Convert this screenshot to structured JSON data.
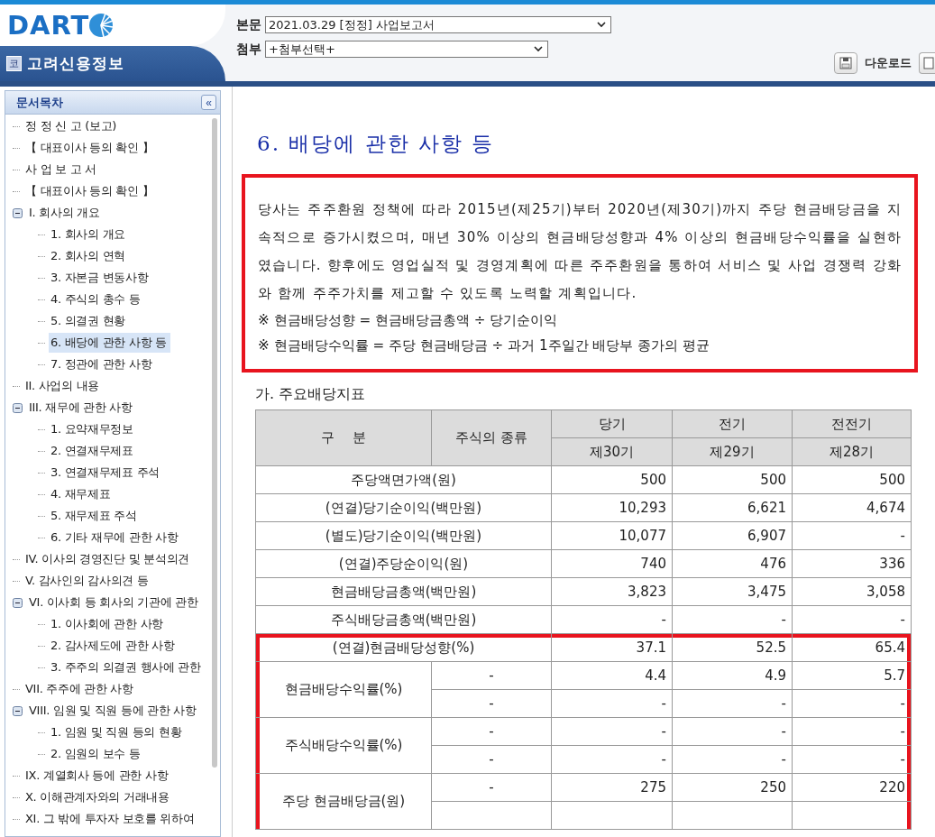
{
  "header": {
    "logo": "DART",
    "company_badge": "코",
    "company": "고려신용정보",
    "fields": [
      {
        "label": "본문",
        "value": "2021.03.29  [정정] 사업보고서"
      },
      {
        "label": "첨부",
        "value": "+첨부선택+"
      }
    ],
    "download_button": "다운로드"
  },
  "sidebar": {
    "title": "문서목차",
    "collapse": "«",
    "items": [
      {
        "label": "정 정 신 고 (보고)",
        "selected": false
      },
      {
        "label": "【 대표이사 등의 확인 】",
        "selected": false
      },
      {
        "label": "사 업 보 고 서",
        "selected": false
      },
      {
        "label": "【 대표이사 등의 확인 】",
        "selected": false
      },
      {
        "label": "I. 회사의 개요",
        "selected": false,
        "expanded": true,
        "children": [
          {
            "label": "1. 회사의 개요",
            "selected": false
          },
          {
            "label": "2. 회사의 연혁",
            "selected": false
          },
          {
            "label": "3. 자본금 변동사항",
            "selected": false
          },
          {
            "label": "4. 주식의 총수 등",
            "selected": false
          },
          {
            "label": "5. 의결권 현황",
            "selected": false
          },
          {
            "label": "6. 배당에 관한 사항 등",
            "selected": true
          },
          {
            "label": "7. 정관에 관한 사항",
            "selected": false
          }
        ]
      },
      {
        "label": "II. 사업의 내용",
        "selected": false
      },
      {
        "label": "III. 재무에 관한 사항",
        "selected": false,
        "expanded": true,
        "children": [
          {
            "label": "1. 요약재무정보",
            "selected": false
          },
          {
            "label": "2. 연결재무제표",
            "selected": false
          },
          {
            "label": "3. 연결재무제표 주석",
            "selected": false
          },
          {
            "label": "4. 재무제표",
            "selected": false
          },
          {
            "label": "5. 재무제표 주석",
            "selected": false
          },
          {
            "label": "6. 기타 재무에 관한 사항",
            "selected": false
          }
        ]
      },
      {
        "label": "IV. 이사의 경영진단 및 분석의견",
        "selected": false
      },
      {
        "label": "V. 감사인의 감사의견 등",
        "selected": false
      },
      {
        "label": "VI. 이사회 등 회사의 기관에 관한",
        "selected": false,
        "expanded": true,
        "children": [
          {
            "label": "1. 이사회에 관한 사항",
            "selected": false
          },
          {
            "label": "2. 감사제도에 관한 사항",
            "selected": false
          },
          {
            "label": "3. 주주의 의결권 행사에 관한",
            "selected": false
          }
        ]
      },
      {
        "label": "VII. 주주에 관한 사항",
        "selected": false
      },
      {
        "label": "VIII. 임원 및 직원 등에 관한 사항",
        "selected": false,
        "expanded": true,
        "children": [
          {
            "label": "1. 임원 및 직원 등의 현황",
            "selected": false
          },
          {
            "label": "2. 임원의 보수 등",
            "selected": false
          }
        ]
      },
      {
        "label": "IX. 계열회사 등에 관한 사항",
        "selected": false
      },
      {
        "label": "X. 이해관계자와의 거래내용",
        "selected": false
      },
      {
        "label": "XI. 그 밖에 투자자 보호를 위하여",
        "selected": false
      }
    ]
  },
  "document": {
    "title": "6. 배당에 관한 사항 등",
    "intro": {
      "highlighted": true,
      "paragraph": "당사는 주주환원 정책에 따라 2015년(제25기)부터 2020년(제30기)까지 주당 현금배당금을 지속적으로 증가시켰으며, 매년 30% 이상의 현금배당성향과 4% 이상의 현금배당수익률을 실현하였습니다. 향후에도 영업실적 및 경영계획에 따른 주주환원을 통하여 서비스 및 사업 경쟁력 강화와 함께 주주가치를 제고할 수 있도록 노력할 계획입니다.",
      "notes": [
        "※ 현금배당성향 = 현금배당금총액 ÷ 당기순이익",
        "※ 현금배당수익률 = 주당 현금배당금 ÷ 과거 1주일간 배당부 종가의 평균"
      ]
    },
    "section": "가. 주요배당지표",
    "table": {
      "columns": [
        {
          "label": "구    분"
        },
        {
          "label": "주식의 종류"
        },
        {
          "label": "당기",
          "sub": "제30기"
        },
        {
          "label": "전기",
          "sub": "제29기"
        },
        {
          "label": "전전기",
          "sub": "제28기"
        }
      ],
      "rows": [
        {
          "kind": "single",
          "label": "주당액면가액(원)",
          "values": [
            "500",
            "500",
            "500"
          ],
          "highlighted": false
        },
        {
          "kind": "single",
          "label": "(연결)당기순이익(백만원)",
          "values": [
            "10,293",
            "6,621",
            "4,674"
          ],
          "highlighted": false
        },
        {
          "kind": "single",
          "label": "(별도)당기순이익(백만원)",
          "values": [
            "10,077",
            "6,907",
            "-"
          ],
          "highlighted": false
        },
        {
          "kind": "single",
          "label": "(연결)주당순이익(원)",
          "values": [
            "740",
            "476",
            "336"
          ],
          "highlighted": false
        },
        {
          "kind": "single",
          "label": "현금배당금총액(백만원)",
          "values": [
            "3,823",
            "3,475",
            "3,058"
          ],
          "highlighted": false
        },
        {
          "kind": "single",
          "label": "주식배당금총액(백만원)",
          "values": [
            "-",
            "-",
            "-"
          ],
          "highlighted": false
        },
        {
          "kind": "single",
          "label": "(연결)현금배당성향(%)",
          "values": [
            "37.1",
            "52.5",
            "65.4"
          ],
          "highlighted": true
        },
        {
          "kind": "split",
          "label": "현금배당수익률(%)",
          "highlighted": true,
          "sub": [
            {
              "stock_type": "-",
              "values": [
                "4.4",
                "4.9",
                "5.7"
              ]
            },
            {
              "stock_type": "-",
              "values": [
                "-",
                "-",
                "-"
              ]
            }
          ]
        },
        {
          "kind": "split",
          "label": "주식배당수익률(%)",
          "highlighted": true,
          "sub": [
            {
              "stock_type": "-",
              "values": [
                "-",
                "-",
                "-"
              ]
            },
            {
              "stock_type": "-",
              "values": [
                "-",
                "-",
                "-"
              ]
            }
          ]
        },
        {
          "kind": "split",
          "label": "주당 현금배당금(원)",
          "highlighted": true,
          "sub": [
            {
              "stock_type": "-",
              "values": [
                "275",
                "250",
                "220"
              ]
            }
          ]
        }
      ]
    }
  }
}
